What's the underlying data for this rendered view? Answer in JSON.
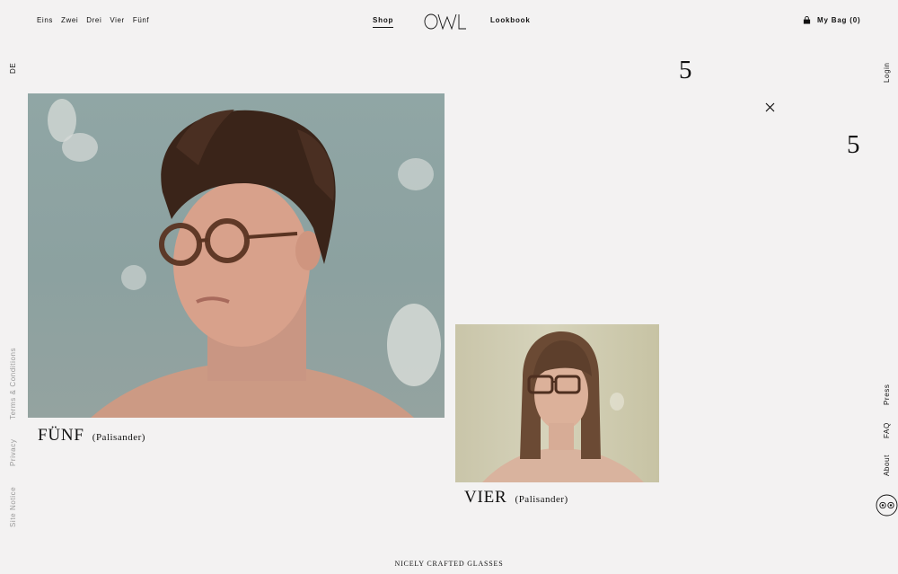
{
  "nav": {
    "left_items": [
      {
        "label": "Eins"
      },
      {
        "label": "Zwei"
      },
      {
        "label": "Drei"
      },
      {
        "label": "Vier"
      },
      {
        "label": "Fünf"
      }
    ],
    "shop": "Shop",
    "logo": "OWL",
    "lookbook": "Lookbook",
    "bag": "My Bag (0)"
  },
  "sidebar_left": {
    "language": "DE",
    "terms": "Terms & Conditions",
    "privacy": "Privacy",
    "site_notice": "Site Notice"
  },
  "sidebar_right": {
    "login": "Login",
    "press": "Press",
    "faq": "FAQ",
    "about": "About"
  },
  "numbers": {
    "first": "5",
    "second": "5"
  },
  "products": [
    {
      "name": "FÜNF",
      "material": "(Palisander)"
    },
    {
      "name": "VIER",
      "material": "(Palisander)"
    }
  ],
  "footer": {
    "tagline": "NICELY CRAFTED GLASSES"
  },
  "colors": {
    "background": "#f3f2f2",
    "text": "#111111",
    "muted": "#999999"
  }
}
